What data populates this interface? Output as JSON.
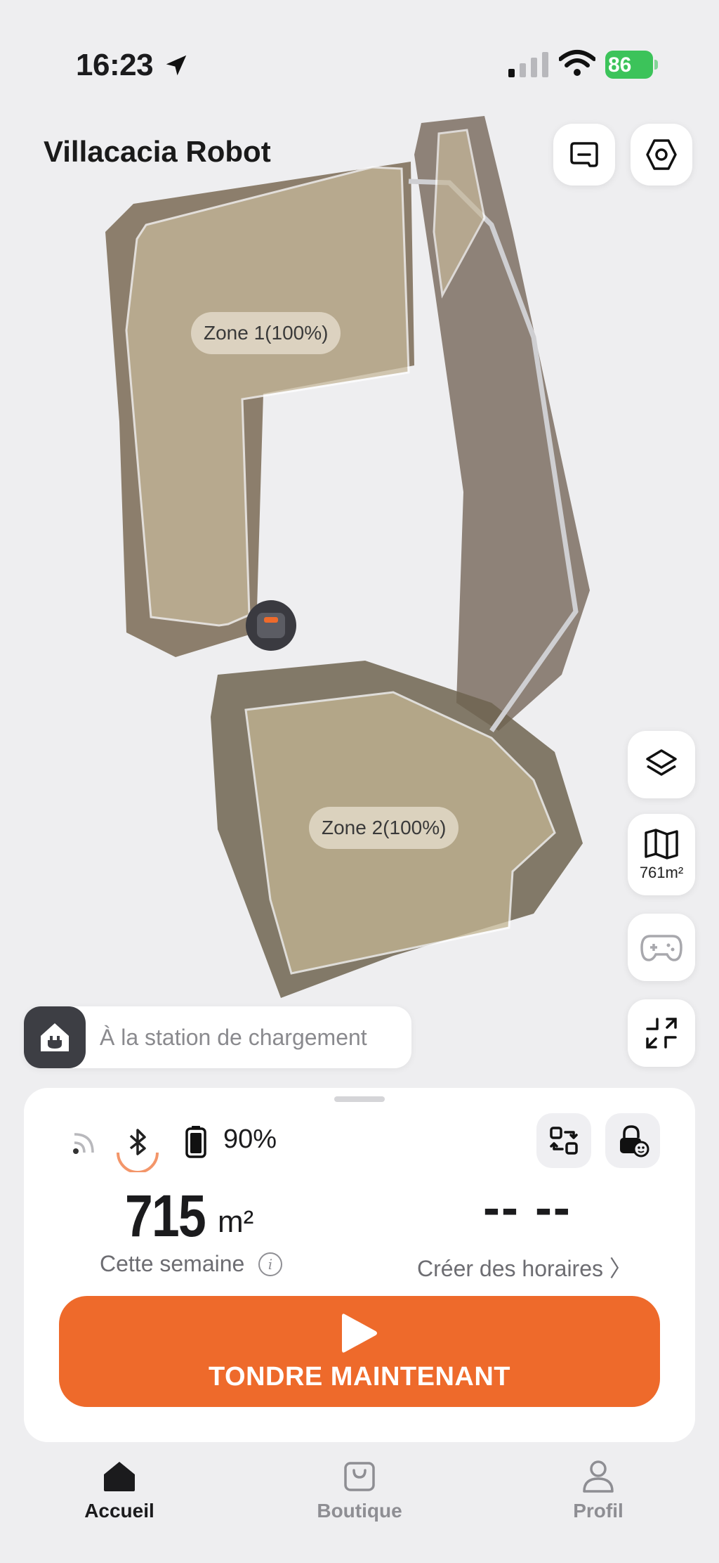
{
  "status_bar": {
    "time": "16:23",
    "battery": "86"
  },
  "header": {
    "title": "Villacacia Robot"
  },
  "map": {
    "zones": [
      {
        "label": "Zone 1(100%)"
      },
      {
        "label": "Zone 2(100%)"
      }
    ]
  },
  "side_controls": {
    "area": "761m²"
  },
  "station": {
    "text": "À la station de chargement"
  },
  "mower": {
    "battery_pct": "90%",
    "week_value": "715",
    "week_unit": "m²",
    "week_label": "Cette semaine",
    "schedule_value": "-- --",
    "schedule_label": "Créer des horaires 〉",
    "mow_button": "TONDRE MAINTENANT"
  },
  "tabs": [
    {
      "label": "Accueil",
      "active": true
    },
    {
      "label": "Boutique",
      "active": false
    },
    {
      "label": "Profil",
      "active": false
    }
  ],
  "colors": {
    "accent": "#ee6a2b",
    "tab_active": "#1b1b1d",
    "tab_inactive": "#8e8e93"
  }
}
